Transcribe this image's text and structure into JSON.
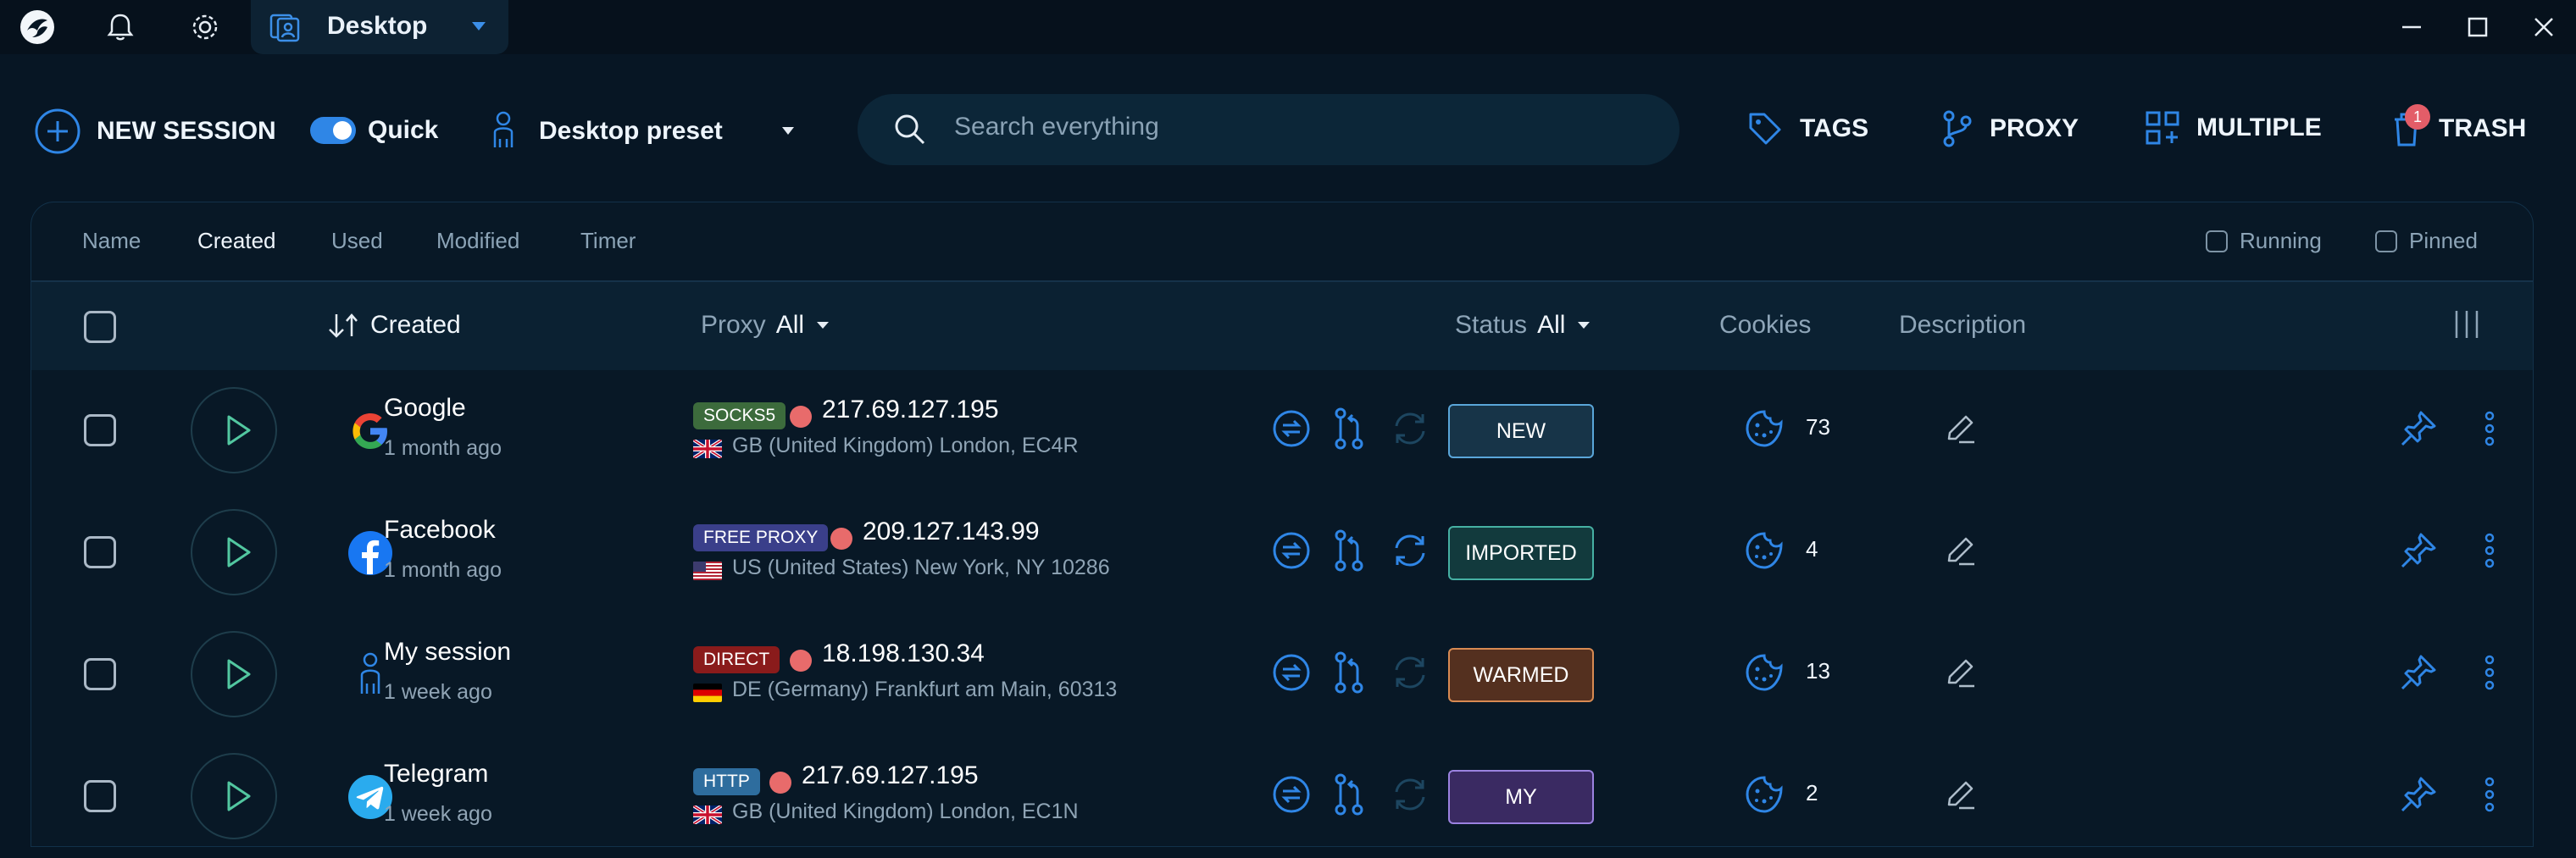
{
  "titlebar": {
    "tab_title": "Desktop"
  },
  "toolbar": {
    "new_session": "NEW SESSION",
    "quick_label": "Quick",
    "quick_on": true,
    "preset": "Desktop preset",
    "search_placeholder": "Search everything",
    "tags": "TAGS",
    "proxy": "PROXY",
    "multiple": "MULTIPLE",
    "trash": "TRASH",
    "trash_count": "1"
  },
  "sort_tabs": [
    "Name",
    "Created",
    "Used",
    "Modified",
    "Timer"
  ],
  "active_sort_tab": "Created",
  "filters": {
    "running": "Running",
    "pinned": "Pinned"
  },
  "header": {
    "created": "Created",
    "proxy": "Proxy",
    "proxy_filter": "All",
    "status": "Status",
    "status_filter": "All",
    "cookies": "Cookies",
    "description": "Description"
  },
  "rows": [
    {
      "name": "Google",
      "created": "1 month ago",
      "icon": "google-logo",
      "proxy_type": "SOCKS5",
      "proxy_type_color": "#3c6b3c",
      "ip": "217.69.127.195",
      "country": "gb",
      "location": "GB (United Kingdom) London, EC4R",
      "status": "NEW",
      "status_bg": "#173448",
      "status_border": "#5aa6d9",
      "cookies": "73",
      "refresh_active": false
    },
    {
      "name": "Facebook",
      "created": "1 month ago",
      "icon": "facebook-logo",
      "proxy_type": "FREE PROXY",
      "proxy_type_color": "#3a3f8a",
      "ip": "209.127.143.99",
      "country": "us",
      "location": "US (United States) New York, NY 10286",
      "status": "IMPORTED",
      "status_bg": "#123a3d",
      "status_border": "#46b0a3",
      "cookies": "4",
      "refresh_active": true
    },
    {
      "name": "My session",
      "created": "1 week ago",
      "icon": "person-icon",
      "proxy_type": "DIRECT",
      "proxy_type_color": "#8a1b1b",
      "ip": "18.198.130.34",
      "country": "de",
      "location": "DE (Germany) Frankfurt am Main, 60313",
      "status": "WARMED",
      "status_bg": "#54301f",
      "status_border": "#d88a52",
      "cookies": "13",
      "refresh_active": false
    },
    {
      "name": "Telegram",
      "created": "1 week ago",
      "icon": "telegram-logo",
      "proxy_type": "HTTP",
      "proxy_type_color": "#2e6d9e",
      "ip": "217.69.127.195",
      "country": "gb",
      "location": "GB (United Kingdom) London, EC1N",
      "status": "MY",
      "status_bg": "#3a2a62",
      "status_border": "#9b82e0",
      "cookies": "2",
      "refresh_active": false
    }
  ],
  "colors": {
    "accent": "#2f86e6",
    "background": "#071624"
  }
}
